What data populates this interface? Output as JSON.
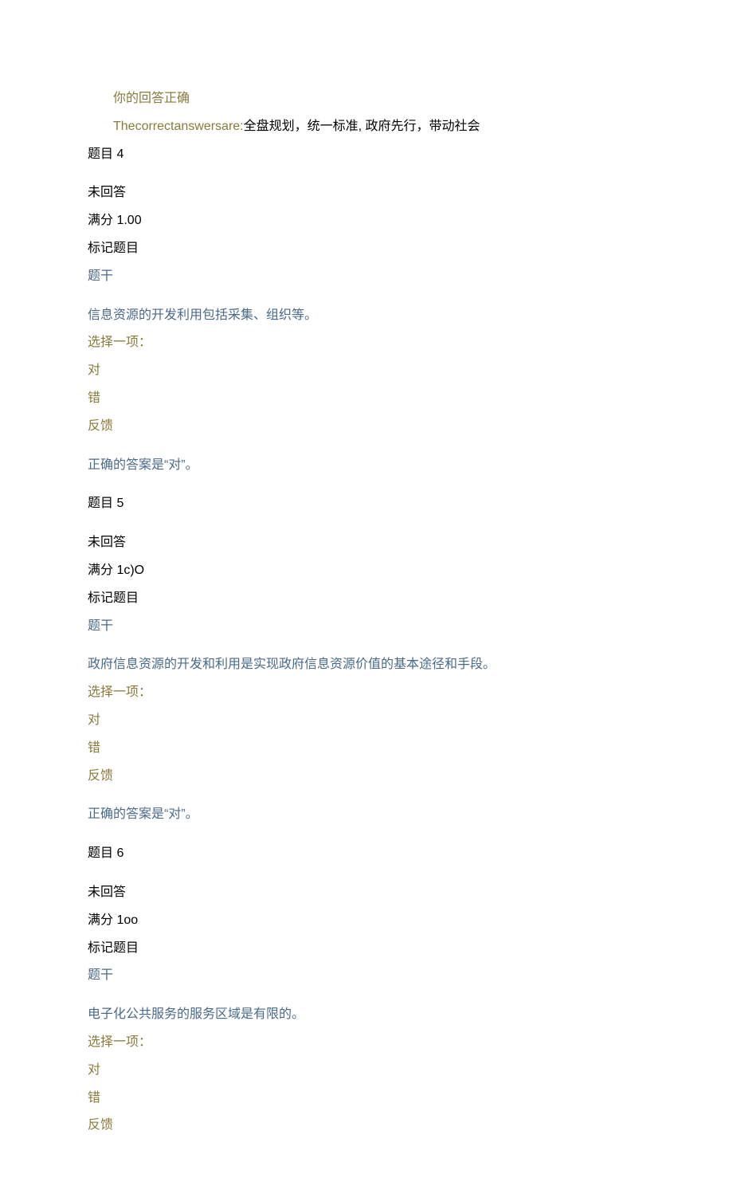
{
  "intro": {
    "correct_note": "你的回答正确",
    "answers_prefix": "Thecorrectanswersare:",
    "answers_body": "全盘规划，统一标准, 政府先行，带动社会"
  },
  "q4": {
    "title": "题目 4",
    "status": "未回答",
    "score": "满分 1.00",
    "flag": "标记题目",
    "stem_label": "题干",
    "stem": "信息资源的开发利用包括采集、组织等。",
    "choose": "选择一项：",
    "opt_true": "对",
    "opt_false": "错",
    "feedback_label": "反馈",
    "answer": "正确的答案是“对”。"
  },
  "q5": {
    "title": "题目 5",
    "status": "未回答",
    "score": "满分 1c)O",
    "flag": "标记题目",
    "stem_label": "题干",
    "stem": "政府信息资源的开发和利用是实现政府信息资源价值的基本途径和手段。",
    "choose": "选择一项：",
    "opt_true": "对",
    "opt_false": "错",
    "feedback_label": "反馈",
    "answer": "正确的答案是“对”。"
  },
  "q6": {
    "title": "题目 6",
    "status": "未回答",
    "score": "满分 1oo",
    "flag": "标记题目",
    "stem_label": "题干",
    "stem": "电子化公共服务的服务区域是有限的。",
    "choose": "选择一项：",
    "opt_true": "对",
    "opt_false": "错",
    "feedback_label": "反馈"
  }
}
